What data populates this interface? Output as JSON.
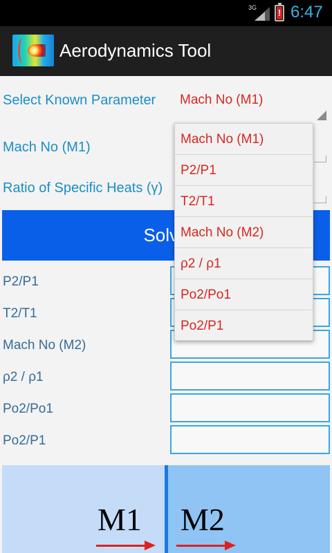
{
  "status_bar": {
    "network": "3G",
    "time": "6:47",
    "battery_icon": "battery-low-icon",
    "signal_icon": "signal-icon"
  },
  "action_bar": {
    "title": "Aerodynamics Tool",
    "app_icon": "shock-wave-app-icon"
  },
  "form": {
    "known_parameter_label": "Select Known Parameter",
    "known_parameter_value": "Mach No (M1)",
    "mach1_label": "Mach No (M1)",
    "gamma_label": "Ratio of Specific Heats (γ)",
    "solve_label": "Solve"
  },
  "results": [
    {
      "label": "P2/P1"
    },
    {
      "label": "T2/T1"
    },
    {
      "label": "Mach No (M2)"
    },
    {
      "label": "ρ2 / ρ1"
    },
    {
      "label": "Po2/Po1"
    },
    {
      "label": "Po2/P1"
    }
  ],
  "dropdown": {
    "options": [
      "Mach No (M1)",
      "P2/P1",
      "T2/T1",
      "Mach No (M2)",
      "ρ2 / ρ1",
      "Po2/Po1",
      "Po2/P1"
    ]
  },
  "diagram": {
    "upstream_label": "M1",
    "downstream_label": "M2"
  },
  "colors": {
    "label_blue": "#1a8fc7",
    "value_red": "#d8261f",
    "solve_button": "#0a5fe8",
    "time_blue": "#33b5e5"
  }
}
